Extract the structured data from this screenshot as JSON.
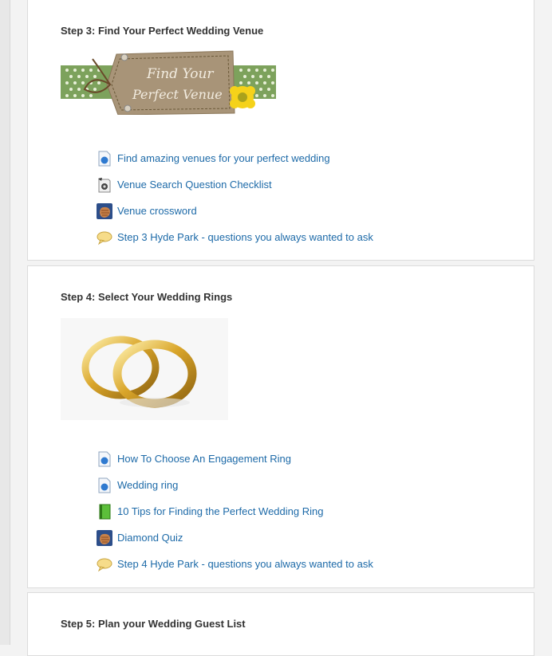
{
  "sections": [
    {
      "title": "Step 3: Find Your Perfect Wedding Venue",
      "banner_text": [
        "Find Your",
        "Perfect Venue"
      ],
      "activities": [
        {
          "label": "Find amazing venues for your perfect wedding",
          "icon": "page-icon"
        },
        {
          "label": "Venue Search Question Checklist",
          "icon": "checklist-icon"
        },
        {
          "label": "Venue crossword",
          "icon": "hand-icon"
        },
        {
          "label": "Step 3 Hyde Park - questions you always wanted to ask",
          "icon": "speech-bubble-icon"
        }
      ]
    },
    {
      "title": "Step 4: Select Your Wedding Rings",
      "activities": [
        {
          "label": "How To Choose An Engagement Ring",
          "icon": "page-icon"
        },
        {
          "label": "Wedding ring",
          "icon": "page-icon"
        },
        {
          "label": "10 Tips for Finding the Perfect Wedding Ring",
          "icon": "book-icon"
        },
        {
          "label": "Diamond Quiz",
          "icon": "hand-icon"
        },
        {
          "label": "Step 4 Hyde Park - questions you always wanted to ask",
          "icon": "speech-bubble-icon"
        }
      ]
    },
    {
      "title": "Step 5: Plan your Wedding Guest List",
      "activities": []
    }
  ]
}
